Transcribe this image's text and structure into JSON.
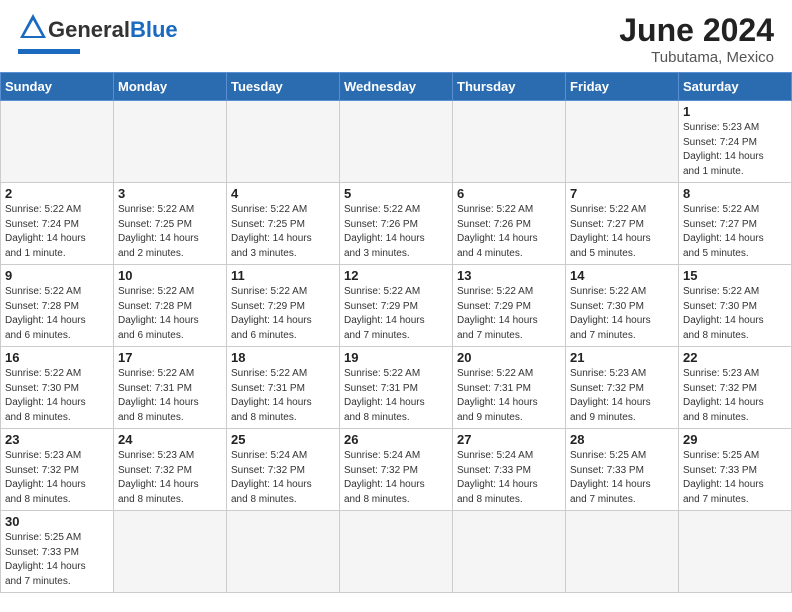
{
  "header": {
    "logo_text_general": "General",
    "logo_text_blue": "Blue",
    "month_year": "June 2024",
    "location": "Tubutama, Mexico"
  },
  "weekdays": [
    "Sunday",
    "Monday",
    "Tuesday",
    "Wednesday",
    "Thursday",
    "Friday",
    "Saturday"
  ],
  "days": {
    "1": {
      "sunrise": "5:23 AM",
      "sunset": "7:24 PM",
      "daylight": "14 hours and 1 minute."
    },
    "2": {
      "sunrise": "5:22 AM",
      "sunset": "7:24 PM",
      "daylight": "14 hours and 1 minute."
    },
    "3": {
      "sunrise": "5:22 AM",
      "sunset": "7:25 PM",
      "daylight": "14 hours and 2 minutes."
    },
    "4": {
      "sunrise": "5:22 AM",
      "sunset": "7:25 PM",
      "daylight": "14 hours and 3 minutes."
    },
    "5": {
      "sunrise": "5:22 AM",
      "sunset": "7:26 PM",
      "daylight": "14 hours and 3 minutes."
    },
    "6": {
      "sunrise": "5:22 AM",
      "sunset": "7:26 PM",
      "daylight": "14 hours and 4 minutes."
    },
    "7": {
      "sunrise": "5:22 AM",
      "sunset": "7:27 PM",
      "daylight": "14 hours and 5 minutes."
    },
    "8": {
      "sunrise": "5:22 AM",
      "sunset": "7:27 PM",
      "daylight": "14 hours and 5 minutes."
    },
    "9": {
      "sunrise": "5:22 AM",
      "sunset": "7:28 PM",
      "daylight": "14 hours and 6 minutes."
    },
    "10": {
      "sunrise": "5:22 AM",
      "sunset": "7:28 PM",
      "daylight": "14 hours and 6 minutes."
    },
    "11": {
      "sunrise": "5:22 AM",
      "sunset": "7:29 PM",
      "daylight": "14 hours and 6 minutes."
    },
    "12": {
      "sunrise": "5:22 AM",
      "sunset": "7:29 PM",
      "daylight": "14 hours and 7 minutes."
    },
    "13": {
      "sunrise": "5:22 AM",
      "sunset": "7:29 PM",
      "daylight": "14 hours and 7 minutes."
    },
    "14": {
      "sunrise": "5:22 AM",
      "sunset": "7:30 PM",
      "daylight": "14 hours and 7 minutes."
    },
    "15": {
      "sunrise": "5:22 AM",
      "sunset": "7:30 PM",
      "daylight": "14 hours and 8 minutes."
    },
    "16": {
      "sunrise": "5:22 AM",
      "sunset": "7:30 PM",
      "daylight": "14 hours and 8 minutes."
    },
    "17": {
      "sunrise": "5:22 AM",
      "sunset": "7:31 PM",
      "daylight": "14 hours and 8 minutes."
    },
    "18": {
      "sunrise": "5:22 AM",
      "sunset": "7:31 PM",
      "daylight": "14 hours and 8 minutes."
    },
    "19": {
      "sunrise": "5:22 AM",
      "sunset": "7:31 PM",
      "daylight": "14 hours and 8 minutes."
    },
    "20": {
      "sunrise": "5:22 AM",
      "sunset": "7:31 PM",
      "daylight": "14 hours and 9 minutes."
    },
    "21": {
      "sunrise": "5:23 AM",
      "sunset": "7:32 PM",
      "daylight": "14 hours and 9 minutes."
    },
    "22": {
      "sunrise": "5:23 AM",
      "sunset": "7:32 PM",
      "daylight": "14 hours and 8 minutes."
    },
    "23": {
      "sunrise": "5:23 AM",
      "sunset": "7:32 PM",
      "daylight": "14 hours and 8 minutes."
    },
    "24": {
      "sunrise": "5:23 AM",
      "sunset": "7:32 PM",
      "daylight": "14 hours and 8 minutes."
    },
    "25": {
      "sunrise": "5:24 AM",
      "sunset": "7:32 PM",
      "daylight": "14 hours and 8 minutes."
    },
    "26": {
      "sunrise": "5:24 AM",
      "sunset": "7:32 PM",
      "daylight": "14 hours and 8 minutes."
    },
    "27": {
      "sunrise": "5:24 AM",
      "sunset": "7:33 PM",
      "daylight": "14 hours and 8 minutes."
    },
    "28": {
      "sunrise": "5:25 AM",
      "sunset": "7:33 PM",
      "daylight": "14 hours and 7 minutes."
    },
    "29": {
      "sunrise": "5:25 AM",
      "sunset": "7:33 PM",
      "daylight": "14 hours and 7 minutes."
    },
    "30": {
      "sunrise": "5:25 AM",
      "sunset": "7:33 PM",
      "daylight": "14 hours and 7 minutes."
    }
  }
}
